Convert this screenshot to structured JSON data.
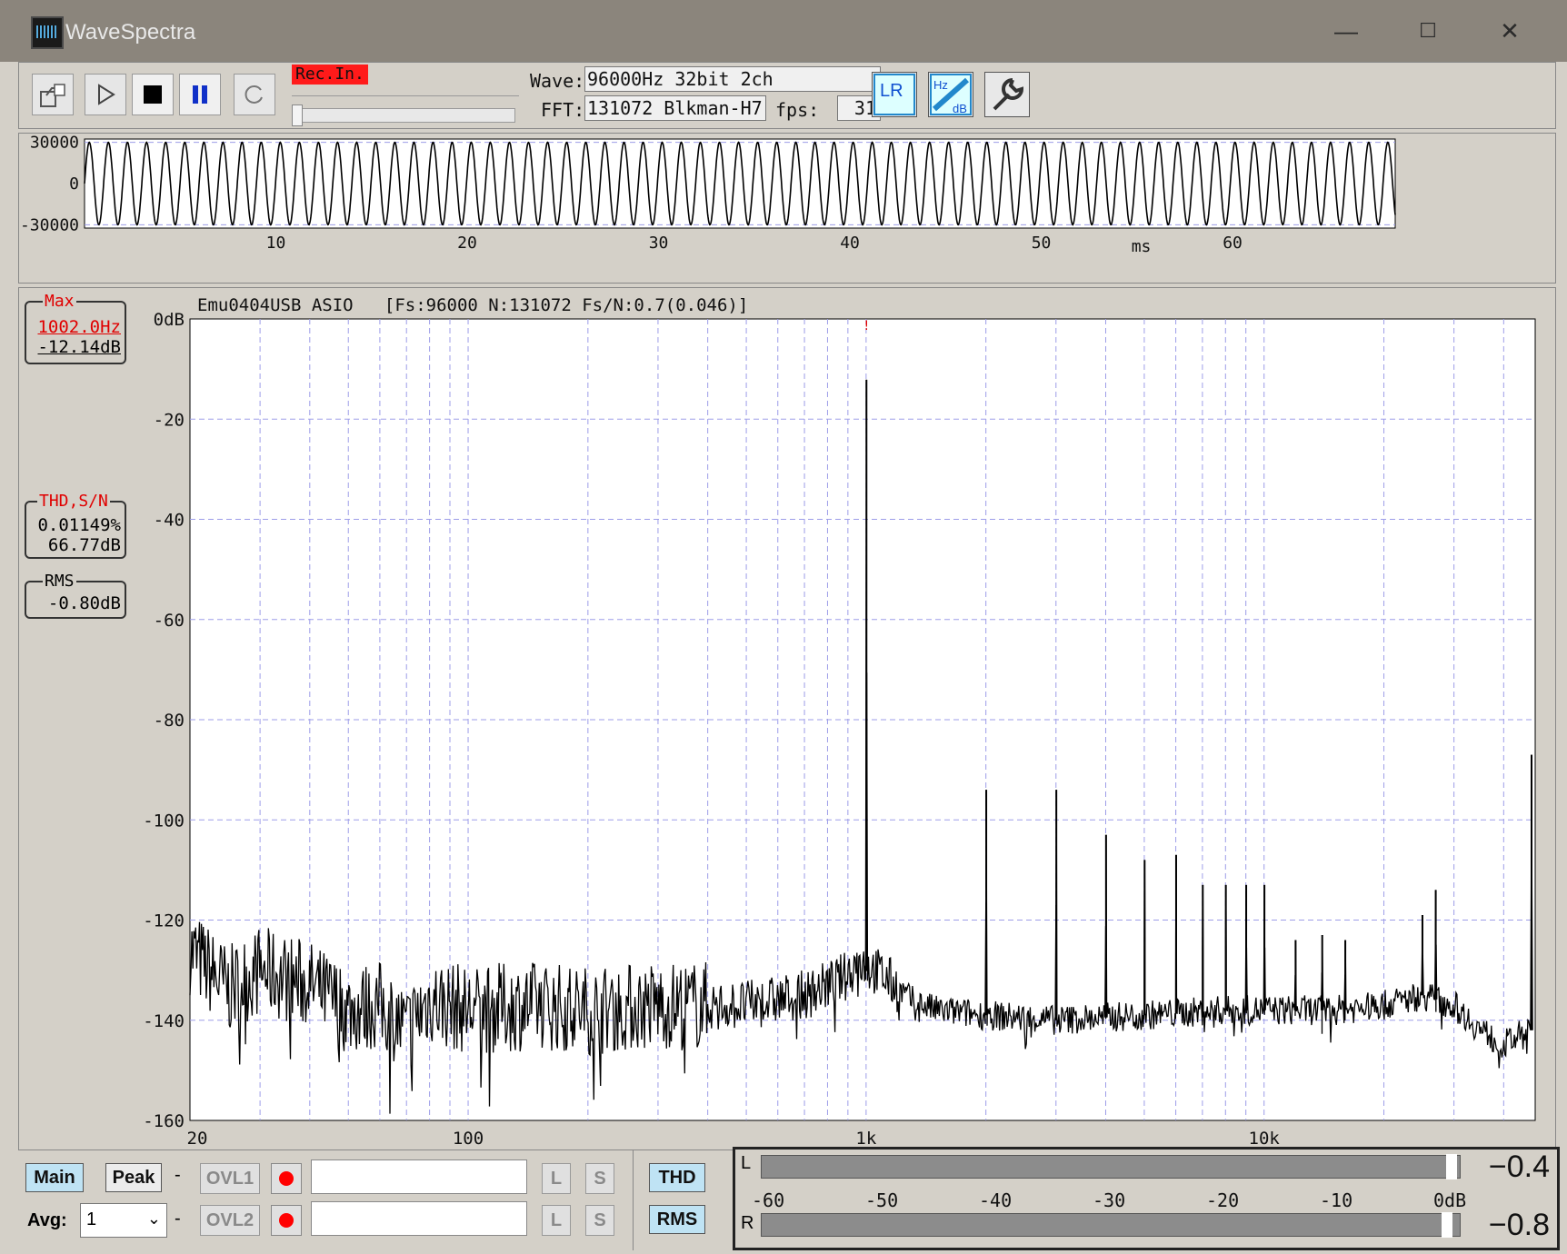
{
  "window": {
    "title": "WaveSpectra",
    "minimize": "—",
    "maximize": "☐",
    "close": "✕"
  },
  "toolbar": {
    "rec_in_label": "Rec.In.",
    "wave_label": "Wave:",
    "wave_value": "96000Hz 32bit 2ch",
    "fft_label": "FFT:",
    "fft_value": "131072 Blkman-H7",
    "fps_label": "fps:",
    "fps_value": "31",
    "icons": [
      "export-icon",
      "play-icon",
      "stop-icon",
      "pause-icon",
      "loop-icon",
      "lr-channel-icon",
      "hz-db-scale-icon",
      "settings-wrench-icon"
    ],
    "lr_label": "LR",
    "hzdb_top": "Hz",
    "hzdb_bottom": "dB"
  },
  "waveform": {
    "y_labels": [
      "30000",
      "0",
      "-30000"
    ],
    "x_labels": [
      "10",
      "20",
      "30",
      "40",
      "50",
      "60"
    ],
    "x_unit": "ms",
    "x_range_ms": [
      0,
      68.5
    ],
    "amplitude": 30000,
    "frequency_hz": 1002
  },
  "spectrum": {
    "header": "Emu0404USB ASIO   [Fs:96000 N:131072 Fs/N:0.7(0.046)]",
    "max_box": {
      "caption": "Max",
      "freq": "1002.0Hz",
      "level": "-12.14dB"
    },
    "thd_box": {
      "caption": "THD,S/N",
      "thd": "0.01149%",
      "sn": "66.77dB"
    },
    "rms_box": {
      "caption": "RMS",
      "value": "-0.80dB"
    },
    "marker_label": "!",
    "y_labels": [
      "0dB",
      "-20",
      "-40",
      "-60",
      "-80",
      "-100",
      "-120",
      "-140",
      "-160"
    ],
    "x_labels": [
      "20",
      "100",
      "1k",
      "10k"
    ]
  },
  "chart_data": [
    {
      "type": "line",
      "title": "",
      "xlabel": "ms",
      "ylabel": "",
      "xlim": [
        0,
        68.5
      ],
      "ylim": [
        -30000,
        30000
      ],
      "series": [
        {
          "frequency_hz": 1002,
          "amplitude": 30000
        }
      ],
      "grid": true
    },
    {
      "type": "line",
      "title": "Emu0404USB ASIO   [Fs:96000 N:131072 Fs/N:0.7(0.046)]",
      "x_scale": "log",
      "xlim": [
        20,
        48000
      ],
      "ylim": [
        -160,
        0
      ],
      "xlabel": "",
      "ylabel": "",
      "noise_floor": [
        [
          20,
          -126
        ],
        [
          25,
          -134
        ],
        [
          30,
          -130
        ],
        [
          40,
          -133
        ],
        [
          50,
          -138
        ],
        [
          60,
          -137
        ],
        [
          70,
          -142
        ],
        [
          80,
          -136
        ],
        [
          100,
          -138
        ],
        [
          150,
          -137
        ],
        [
          200,
          -138
        ],
        [
          300,
          -137
        ],
        [
          500,
          -137
        ],
        [
          700,
          -135
        ],
        [
          800,
          -133
        ],
        [
          900,
          -131
        ],
        [
          950,
          -128
        ],
        [
          1100,
          -131
        ],
        [
          1300,
          -136
        ],
        [
          1500,
          -138
        ],
        [
          2000,
          -139
        ],
        [
          3000,
          -140
        ],
        [
          5000,
          -139
        ],
        [
          8000,
          -138
        ],
        [
          10000,
          -138
        ],
        [
          15000,
          -138
        ],
        [
          20000,
          -137
        ],
        [
          25000,
          -135
        ],
        [
          30000,
          -137
        ],
        [
          35000,
          -142
        ],
        [
          40000,
          -145
        ],
        [
          46000,
          -142
        ]
      ],
      "peaks": [
        {
          "freq": 1002,
          "level": -12.14
        },
        {
          "freq": 2004,
          "level": -94
        },
        {
          "freq": 3006,
          "level": -94
        },
        {
          "freq": 4008,
          "level": -103
        },
        {
          "freq": 5010,
          "level": -108
        },
        {
          "freq": 6012,
          "level": -107
        },
        {
          "freq": 7014,
          "level": -113
        },
        {
          "freq": 8016,
          "level": -113
        },
        {
          "freq": 9018,
          "level": -113
        },
        {
          "freq": 10020,
          "level": -113
        },
        {
          "freq": 12000,
          "level": -124
        },
        {
          "freq": 14000,
          "level": -123
        },
        {
          "freq": 16000,
          "level": -124
        },
        {
          "freq": 25000,
          "level": -119
        },
        {
          "freq": 27000,
          "level": -114
        },
        {
          "freq": 47000,
          "level": -87
        }
      ],
      "grid": true
    }
  ],
  "bottom": {
    "main": "Main",
    "peak": "Peak",
    "dash1": "-",
    "dash2": "-",
    "ovl1": "OVL1",
    "ovl2": "OVL2",
    "avg_label": "Avg:",
    "avg_value": "1",
    "l": "L",
    "s": "S",
    "thd": "THD",
    "rms": "RMS"
  },
  "meter": {
    "l_label": "L",
    "r_label": "R",
    "l_value": "−0.4",
    "r_value": "−0.8",
    "l_level_db": -0.4,
    "r_level_db": -0.8,
    "scale": [
      "-60",
      "-50",
      "-40",
      "-30",
      "-20",
      "-10",
      "0dB"
    ]
  },
  "colors": {
    "title_bar": "#8b857c",
    "panel": "#d4d0c8",
    "grid": "#9d9de8",
    "trace": "#000000",
    "marker": "#e00000",
    "main_btn": "#bfe3f4",
    "rec_dot": "#ff0000"
  }
}
